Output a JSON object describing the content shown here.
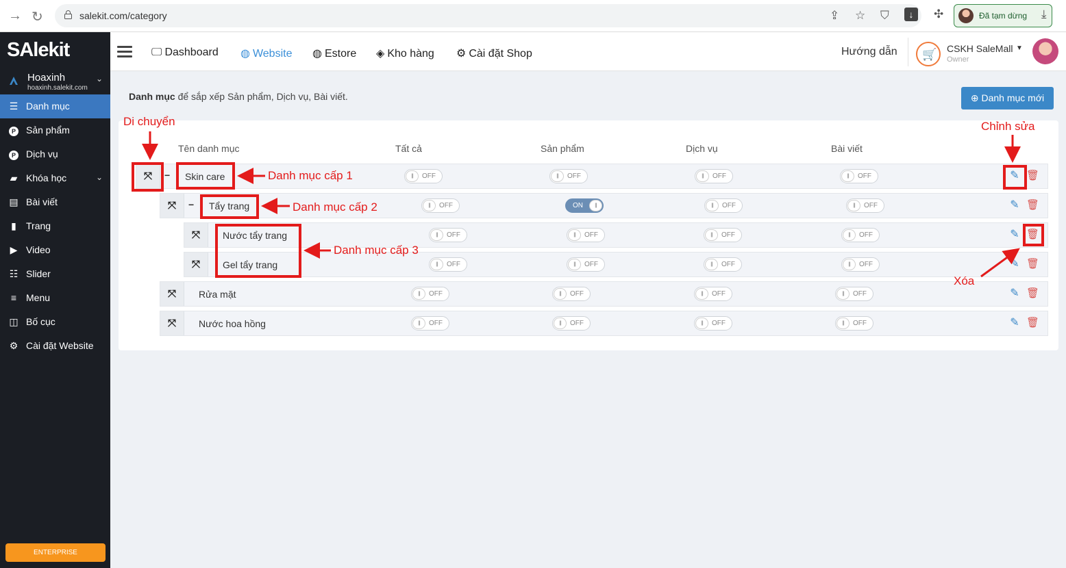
{
  "browser": {
    "url": "salekit.com/category",
    "profile_label": "Đã tạm dừng"
  },
  "sidebar": {
    "logo": "SAlekit",
    "shop_name": "Hoaxinh",
    "shop_domain": "hoaxinh.salekit.com",
    "items": [
      {
        "label": "Danh mục",
        "icon": "list-icon"
      },
      {
        "label": "Sản phẩm",
        "icon": "product-p-icon"
      },
      {
        "label": "Dịch vụ",
        "icon": "service-p-icon"
      },
      {
        "label": "Khóa học",
        "icon": "book-icon"
      },
      {
        "label": "Bài viết",
        "icon": "newspaper-icon"
      },
      {
        "label": "Trang",
        "icon": "page-icon"
      },
      {
        "label": "Video",
        "icon": "video-icon"
      },
      {
        "label": "Slider",
        "icon": "sliders-icon"
      },
      {
        "label": "Menu",
        "icon": "menu-icon"
      },
      {
        "label": "Bố cục",
        "icon": "layout-icon"
      },
      {
        "label": "Cài đặt Website",
        "icon": "gear-icon"
      }
    ],
    "plan": "ENTERPRISE"
  },
  "topbar": {
    "nav": [
      {
        "label": "Dashboard",
        "icon": "monitor-icon"
      },
      {
        "label": "Website",
        "icon": "globe-icon"
      },
      {
        "label": "Estore",
        "icon": "globe-icon"
      },
      {
        "label": "Kho hàng",
        "icon": "layers-icon"
      },
      {
        "label": "Cài đặt Shop",
        "icon": "gear-icon"
      }
    ],
    "guide": "Hướng dẫn",
    "user_name": "CSKH SaleMall",
    "user_role": "Owner"
  },
  "main": {
    "intro_bold": "Danh mục",
    "intro_rest": " để sắp xếp Sản phẩm, Dịch vụ, Bài viết.",
    "new_button": "Danh mục mới",
    "columns": [
      "Tên danh mục",
      "Tất cả",
      "Sản phẩm",
      "Dịch vụ",
      "Bài viết"
    ],
    "toggle_on": "ON",
    "toggle_off": "OFF",
    "rows": [
      {
        "name": "Skin care",
        "level": 1,
        "toggles": [
          "OFF",
          "OFF",
          "OFF",
          "OFF"
        ]
      },
      {
        "name": "Tẩy trang",
        "level": 2,
        "toggles": [
          "OFF",
          "ON",
          "OFF",
          "OFF"
        ]
      },
      {
        "name": "Nước tẩy trang",
        "level": 3,
        "toggles": [
          "OFF",
          "OFF",
          "OFF",
          "OFF"
        ]
      },
      {
        "name": "Gel tẩy trang",
        "level": 3,
        "toggles": [
          "OFF",
          "OFF",
          "OFF",
          "OFF"
        ]
      },
      {
        "name": "Rửa mặt",
        "level": 2,
        "toggles": [
          "OFF",
          "OFF",
          "OFF",
          "OFF"
        ]
      },
      {
        "name": "Nước hoa hồng",
        "level": 2,
        "toggles": [
          "OFF",
          "OFF",
          "OFF",
          "OFF"
        ]
      }
    ]
  },
  "annotations": {
    "move": "Di chuyển",
    "edit": "Chỉnh sửa",
    "level1": "Danh mục cấp 1",
    "level2": "Danh mục cấp 2",
    "level3": "Danh mục cấp 3",
    "delete": "Xóa",
    "color": "#e31b1b"
  }
}
